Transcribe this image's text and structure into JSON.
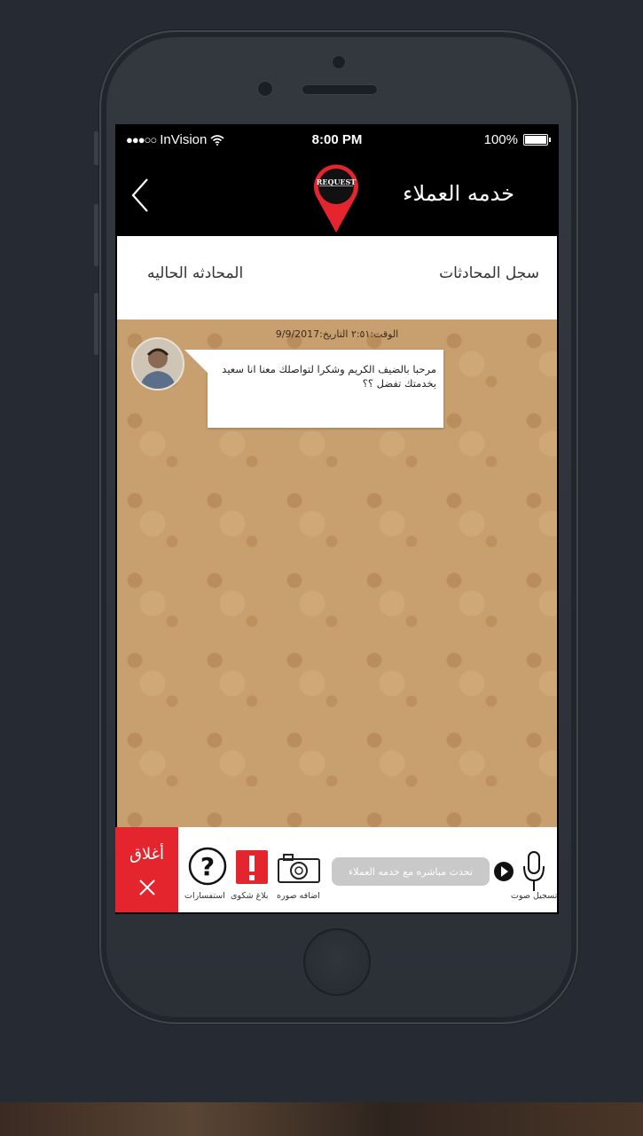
{
  "status_bar": {
    "signal_dots": "●●●○○",
    "carrier": "InVision",
    "time": "8:00 PM",
    "battery": "100%"
  },
  "header": {
    "title": "خدمه العملاء",
    "logo_text": "REQUEST",
    "back_icon": "chevron-left-icon"
  },
  "tabs": [
    {
      "label": "سجل المحادثات"
    },
    {
      "label": "المحادثه الحاليه"
    }
  ],
  "chat": {
    "timestamp": "الوقت:٢:٥١ التاريخ:9/9/2017",
    "messages": [
      {
        "text": "مرحبا بالضيف الكريم وشكرا لتواصلك معنا انا سعيد بخدمتك تفضل ؟؟"
      }
    ]
  },
  "toolbar": {
    "close_label": "أغلاق",
    "inquiries_label": "استفسارات",
    "complaint_label": "بلاغ شكوى",
    "add_photo_label": "اضافه صوره",
    "input_placeholder": "تحدث مباشره مع خدمه العملاء",
    "record_label": "تسجيل صوت"
  },
  "colors": {
    "accent_red": "#e4252e",
    "chat_background": "#c8a070",
    "nav_background": "#000000"
  }
}
